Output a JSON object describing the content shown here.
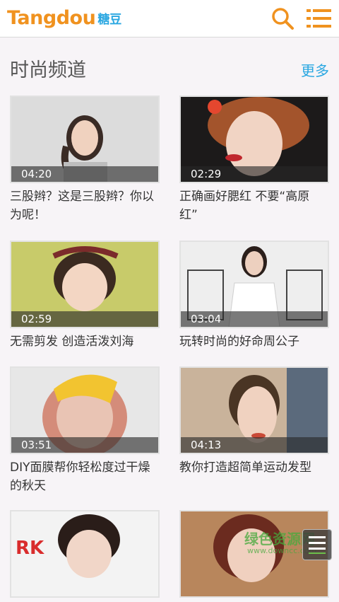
{
  "header": {
    "logo_text": "Tangdou",
    "logo_cn": "糖豆",
    "accent_color": "#f0921f"
  },
  "section": {
    "title": "时尚频道",
    "more_label": "更多"
  },
  "videos": [
    {
      "duration": "04:20",
      "title": "三股辫？这是三股辫？你以为呢！"
    },
    {
      "duration": "02:29",
      "title": "正确画好腮红 不要“高原红”"
    },
    {
      "duration": "02:59",
      "title": "无需剪发 创造活泼刘海"
    },
    {
      "duration": "03:04",
      "title": "玩转时尚的好命周公子"
    },
    {
      "duration": "03:51",
      "title": "DIY面膜帮你轻松度过干燥的秋天"
    },
    {
      "duration": "04:13",
      "title": "教你打造超简单运动发型"
    },
    {
      "duration": "",
      "title": ""
    },
    {
      "duration": "",
      "title": ""
    }
  ],
  "watermark": {
    "text": "绿色资源网",
    "url": "www.downcc.com"
  }
}
